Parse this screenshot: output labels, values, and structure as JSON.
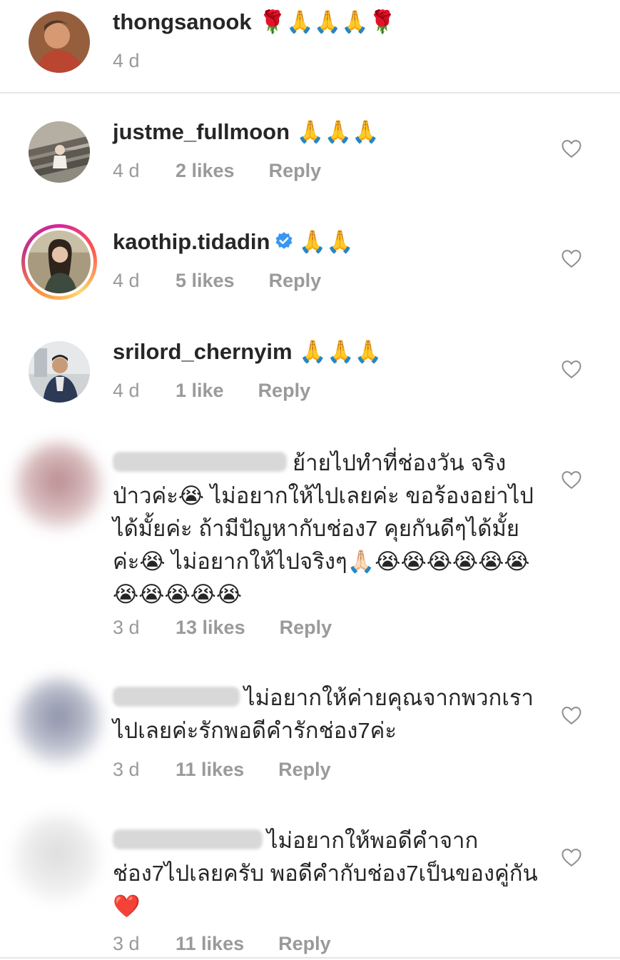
{
  "comments": [
    {
      "username": "thongsanook",
      "text": " 🌹🙏🙏🙏🌹",
      "time": "4 d",
      "likes": "",
      "reply": ""
    },
    {
      "username": "justme_fullmoon",
      "text": " 🙏🙏🙏",
      "time": "4 d",
      "likes": "2 likes",
      "reply": "Reply"
    },
    {
      "username": "kaothip.tidadin",
      "text": "🙏🙏",
      "time": "4 d",
      "likes": "5 likes",
      "reply": "Reply"
    },
    {
      "username": "srilord_chernyim",
      "text": " 🙏🙏🙏",
      "time": "4 d",
      "likes": "1 like",
      "reply": "Reply"
    },
    {
      "username": "",
      "text": "ย้ายไปทำที่ช่องวัน จริงป่าวค่ะ😭 ไม่อยากให้ไปเลยค่ะ ขอร้องอย่าไปได้มั้ยค่ะ ถ้ามีปัญหากับช่อง7 คุยกันดีๆได้มั้ยค่ะ😭 ไม่อยากให้ไปจริงๆ🙏🏻😭😭😭😭😭😭😭😭😭😭😭",
      "time": "3 d",
      "likes": "13 likes",
      "reply": "Reply"
    },
    {
      "username": "",
      "text": "ไม่อยากให้ค่ายคุณจากพวกเราไปเลยค่ะรักพอดีคำรักช่อง7ค่ะ",
      "time": "3 d",
      "likes": "11 likes",
      "reply": "Reply"
    },
    {
      "username": "",
      "text": "ไม่อยากให้พอดีคำจากช่อง7ไปเลยครับ พอดีคำกับช่อง7เป็นของคู่กัน❤️",
      "time": "3 d",
      "likes": "11 likes",
      "reply": "Reply"
    }
  ]
}
